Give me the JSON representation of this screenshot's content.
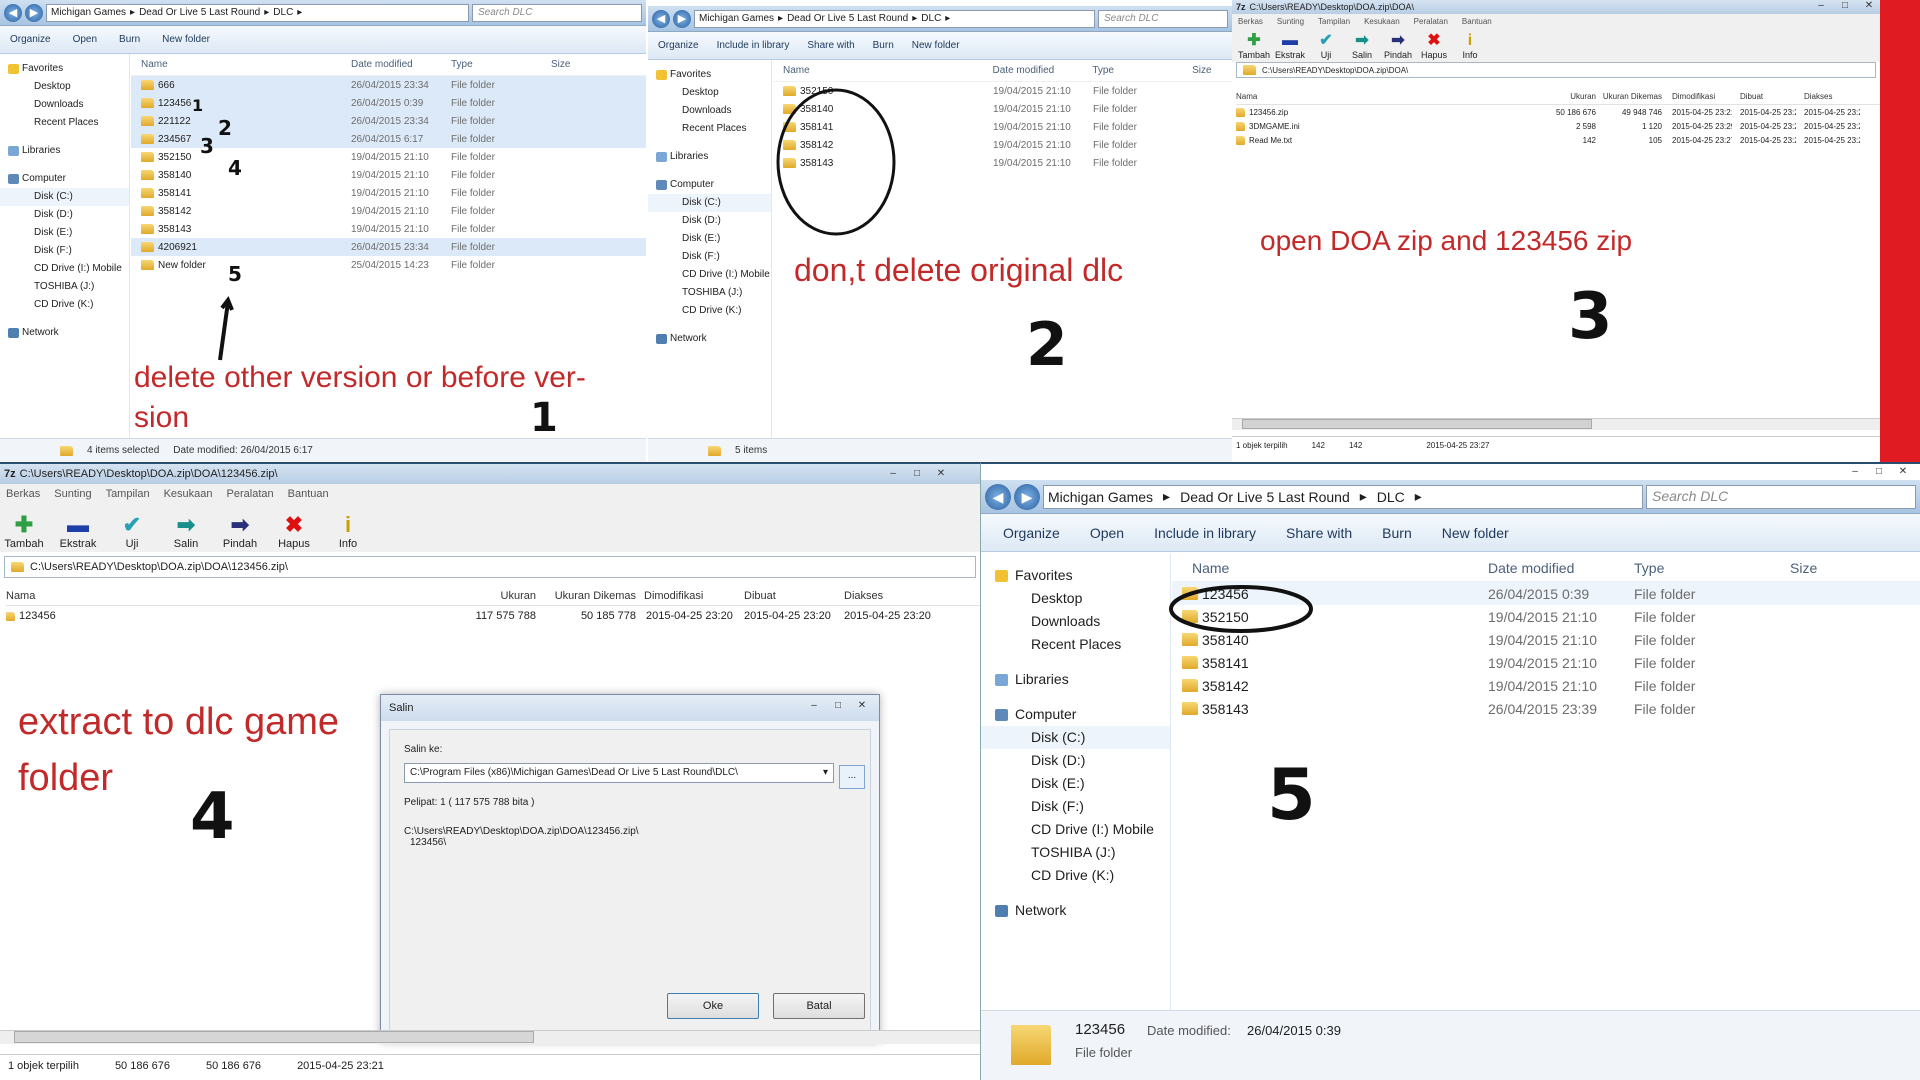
{
  "panel1": {
    "crumbs": [
      "Michigan Games",
      "Dead Or Live 5 Last Round",
      "DLC"
    ],
    "search_placeholder": "Search DLC",
    "toolbar": [
      "Organize",
      "Open",
      "Burn",
      "New folder"
    ],
    "nav": {
      "favorites": "Favorites",
      "fav_items": [
        "Desktop",
        "Downloads",
        "Recent Places"
      ],
      "libraries": "Libraries",
      "computer": "Computer",
      "drives": [
        "Disk (C:)",
        "Disk (D:)",
        "Disk (E:)",
        "Disk (F:)",
        "CD Drive (I:) Mobile",
        "TOSHIBA (J:)",
        "CD Drive (K:)"
      ],
      "network": "Network"
    },
    "columns": [
      "Name",
      "Date modified",
      "Type",
      "Size"
    ],
    "rows": [
      {
        "name": "666",
        "date": "26/04/2015 23:34",
        "type": "File folder",
        "selected": true
      },
      {
        "name": "123456",
        "date": "26/04/2015 0:39",
        "type": "File folder",
        "selected": true
      },
      {
        "name": "221122",
        "date": "26/04/2015 23:34",
        "type": "File folder",
        "selected": true
      },
      {
        "name": "234567",
        "date": "26/04/2015 6:17",
        "type": "File folder",
        "selected": true
      },
      {
        "name": "352150",
        "date": "19/04/2015 21:10",
        "type": "File folder",
        "selected": false
      },
      {
        "name": "358140",
        "date": "19/04/2015 21:10",
        "type": "File folder",
        "selected": false
      },
      {
        "name": "358141",
        "date": "19/04/2015 21:10",
        "type": "File folder",
        "selected": false
      },
      {
        "name": "358142",
        "date": "19/04/2015 21:10",
        "type": "File folder",
        "selected": false
      },
      {
        "name": "358143",
        "date": "19/04/2015 21:10",
        "type": "File folder",
        "selected": false
      },
      {
        "name": "4206921",
        "date": "26/04/2015 23:34",
        "type": "File folder",
        "selected": true
      },
      {
        "name": "New folder",
        "date": "25/04/2015 14:23",
        "type": "File folder",
        "selected": false
      }
    ],
    "status_count": "4 items selected",
    "status_date": "Date modified: 26/04/2015 6:17",
    "annotation": "delete other version or before ver-\nsion",
    "step": "1",
    "marks": [
      "1",
      "2",
      "3",
      "4",
      "5"
    ]
  },
  "panel2": {
    "crumbs": [
      "Michigan Games",
      "Dead Or Live 5 Last Round",
      "DLC"
    ],
    "search_placeholder": "Search DLC",
    "toolbar": [
      "Organize",
      "Include in library",
      "Share with",
      "Burn",
      "New folder"
    ],
    "columns": [
      "Name",
      "Date modified",
      "Type",
      "Size"
    ],
    "rows": [
      {
        "name": "352150",
        "date": "19/04/2015 21:10",
        "type": "File folder"
      },
      {
        "name": "358140",
        "date": "19/04/2015 21:10",
        "type": "File folder"
      },
      {
        "name": "358141",
        "date": "19/04/2015 21:10",
        "type": "File folder"
      },
      {
        "name": "358142",
        "date": "19/04/2015 21:10",
        "type": "File folder"
      },
      {
        "name": "358143",
        "date": "19/04/2015 21:10",
        "type": "File folder"
      }
    ],
    "status_count": "5 items",
    "annotation": "don,t delete original dlc",
    "step": "2"
  },
  "panel3": {
    "title": "C:\\Users\\READY\\Desktop\\DOA.zip\\DOA\\",
    "menu": [
      "Berkas",
      "Sunting",
      "Tampilan",
      "Kesukaan",
      "Peralatan",
      "Bantuan"
    ],
    "tools": [
      "Tambah",
      "Ekstrak",
      "Uji",
      "Salin",
      "Pindah",
      "Hapus",
      "Info"
    ],
    "path": "C:\\Users\\READY\\Desktop\\DOA.zip\\DOA\\",
    "columns": [
      "Nama",
      "Ukuran",
      "Ukuran Dikemas",
      "Dimodifikasi",
      "Dibuat",
      "Diakses"
    ],
    "rows": [
      {
        "name": "123456.zip",
        "size": "50 186 676",
        "packed": "49 948 746",
        "mod": "2015-04-25 23:21",
        "created": "2015-04-25 23:21",
        "accessed": "2015-04-25 23:21"
      },
      {
        "name": "3DMGAME.ini",
        "size": "2 598",
        "packed": "1 120",
        "mod": "2015-04-25 23:29",
        "created": "2015-04-25 23:28",
        "accessed": "2015-04-25 23:28"
      },
      {
        "name": "Read Me.txt",
        "size": "142",
        "packed": "105",
        "mod": "2015-04-25 23:27",
        "created": "2015-04-25 23:27",
        "accessed": "2015-04-25 23:27"
      }
    ],
    "status": [
      "1 objek terpilih",
      "142",
      "142",
      "2015-04-25 23:27"
    ],
    "annotation": "open DOA zip and 123456 zip",
    "step": "3"
  },
  "panel4": {
    "title": "C:\\Users\\READY\\Desktop\\DOA.zip\\DOA\\123456.zip\\",
    "menu": [
      "Berkas",
      "Sunting",
      "Tampilan",
      "Kesukaan",
      "Peralatan",
      "Bantuan"
    ],
    "tools": [
      "Tambah",
      "Ekstrak",
      "Uji",
      "Salin",
      "Pindah",
      "Hapus",
      "Info"
    ],
    "path": "C:\\Users\\READY\\Desktop\\DOA.zip\\DOA\\123456.zip\\",
    "columns": [
      "Nama",
      "Ukuran",
      "Ukuran Dikemas",
      "Dimodifikasi",
      "Dibuat",
      "Diakses"
    ],
    "rows": [
      {
        "name": "123456",
        "size": "117 575 788",
        "packed": "50 185 778",
        "mod": "2015-04-25 23:20",
        "created": "2015-04-25 23:20",
        "accessed": "2015-04-25 23:20"
      }
    ],
    "status": [
      "1 objek terpilih",
      "50 186 676",
      "50 186 676",
      "2015-04-25 23:21"
    ],
    "annotation": "extract to dlc game\nfolder",
    "step": "4",
    "dialog": {
      "title": "Salin",
      "copy_to_label": "Salin ke:",
      "destination": "C:\\Program Files (x86)\\Michigan Games\\Dead Or Live 5 Last Round\\DLC\\",
      "browse": "...",
      "files_info": "Pelipat: 1    ( 117 575 788 bita )",
      "source_line1": "C:\\Users\\READY\\Desktop\\DOA.zip\\DOA\\123456.zip\\",
      "source_line2": "123456\\",
      "ok": "Oke",
      "cancel": "Batal"
    }
  },
  "panel5": {
    "crumbs": [
      "Michigan Games",
      "Dead Or Live 5 Last Round",
      "DLC"
    ],
    "search_placeholder": "Search DLC",
    "toolbar": [
      "Organize",
      "Open",
      "Include in library",
      "Share with",
      "Burn",
      "New folder"
    ],
    "nav": {
      "favorites": "Favorites",
      "fav_items": [
        "Desktop",
        "Downloads",
        "Recent Places"
      ],
      "libraries": "Libraries",
      "computer": "Computer",
      "drives": [
        "Disk (C:)",
        "Disk (D:)",
        "Disk (E:)",
        "Disk (F:)",
        "CD Drive (I:) Mobile",
        "TOSHIBA (J:)",
        "CD Drive (K:)"
      ],
      "network": "Network"
    },
    "columns": [
      "Name",
      "Date modified",
      "Type",
      "Size"
    ],
    "rows": [
      {
        "name": "123456",
        "date": "26/04/2015 0:39",
        "type": "File folder"
      },
      {
        "name": "352150",
        "date": "19/04/2015 21:10",
        "type": "File folder"
      },
      {
        "name": "358140",
        "date": "19/04/2015 21:10",
        "type": "File folder"
      },
      {
        "name": "358141",
        "date": "19/04/2015 21:10",
        "type": "File folder"
      },
      {
        "name": "358142",
        "date": "19/04/2015 21:10",
        "type": "File folder"
      },
      {
        "name": "358143",
        "date": "26/04/2015 23:39",
        "type": "File folder"
      }
    ],
    "details_name": "123456",
    "details_date_label": "Date modified:",
    "details_date": "26/04/2015 0:39",
    "details_type": "File folder",
    "step": "5"
  },
  "colors": {
    "annotation": "#c22a2a",
    "red_bar": "#e11b22",
    "selection": "#dce9f8"
  }
}
